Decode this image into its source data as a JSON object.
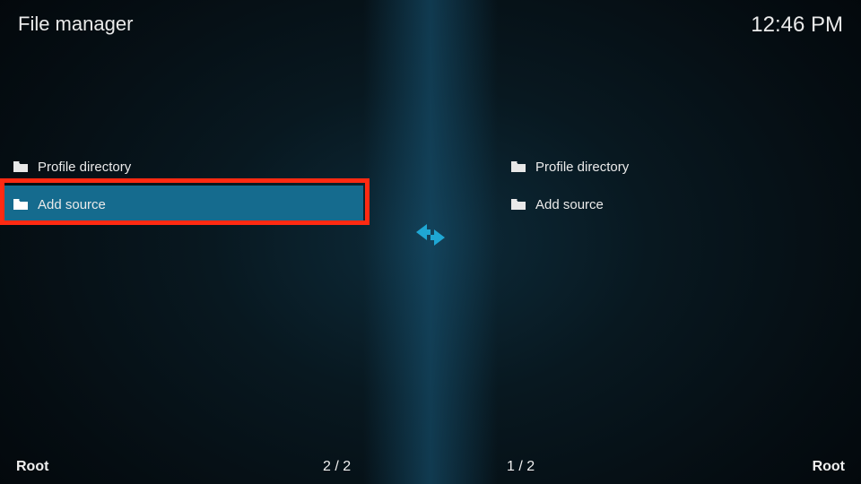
{
  "header": {
    "title": "File manager",
    "clock": "12:46 PM"
  },
  "left_pane": {
    "items": [
      {
        "icon": "folder-icon",
        "label": "Profile directory",
        "selected": false
      },
      {
        "icon": "folder-icon",
        "label": "Add source",
        "selected": true
      }
    ]
  },
  "right_pane": {
    "items": [
      {
        "icon": "folder-icon",
        "label": "Profile directory",
        "selected": false
      },
      {
        "icon": "folder-icon",
        "label": "Add source",
        "selected": false
      }
    ]
  },
  "footer": {
    "left_root": "Root",
    "left_count": "2 / 2",
    "right_count": "1 / 2",
    "right_root": "Root"
  },
  "colors": {
    "accent": "#1fa7d4",
    "highlight_border": "#ff2a12",
    "selected_bg": "#156b8e"
  }
}
